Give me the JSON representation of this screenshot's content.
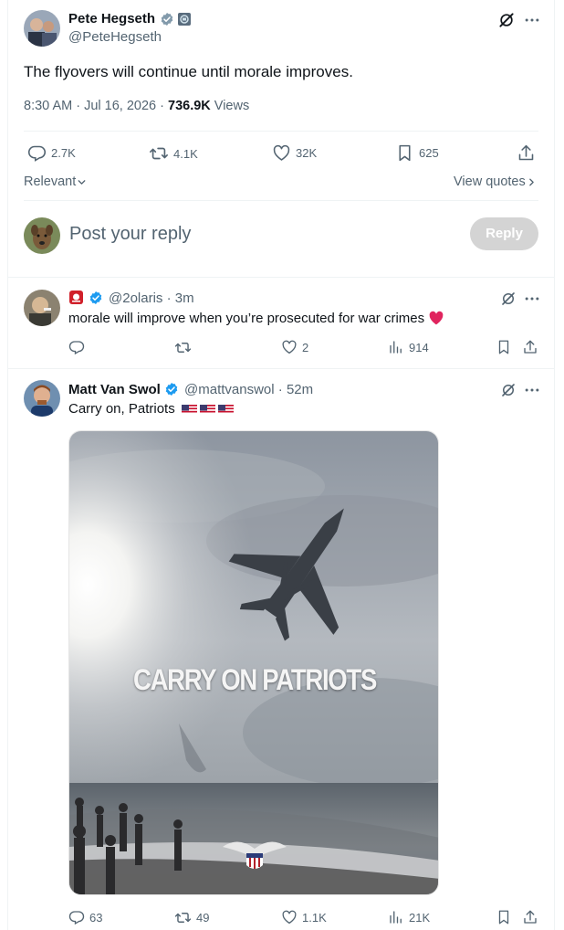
{
  "main_tweet": {
    "author_name": "Pete Hegseth",
    "author_handle": "@PeteHegseth",
    "text": "The flyovers will continue until morale improves.",
    "time": "8:30 AM",
    "date": "Jul 16, 2026",
    "views_count": "736.9K",
    "views_label": "Views",
    "stats": {
      "replies": "2.7K",
      "reposts": "4.1K",
      "likes": "32K",
      "bookmarks": "625"
    }
  },
  "sort": {
    "label": "Relevant",
    "view_quotes": "View quotes"
  },
  "composer": {
    "placeholder": "Post your reply",
    "reply_label": "Reply"
  },
  "replies": [
    {
      "author_handle": "@2olaris",
      "time": "3m",
      "text": "morale will improve when you’re prosecuted for war crimes",
      "stats": {
        "replies": "",
        "reposts": "",
        "likes": "2",
        "views": "914"
      }
    },
    {
      "author_name": "Matt Van Swol",
      "author_handle": "@mattvanswol",
      "time": "52m",
      "text": "Carry on, Patriots",
      "media_caption": "CARRY ON PATRIOTS",
      "stats": {
        "replies": "63",
        "reposts": "49",
        "likes": "1.1K",
        "views": "21K"
      }
    }
  ],
  "colors": {
    "verified": "#1d9bf0",
    "heart": "#e0245e",
    "reply_button": "#d4d4d4"
  },
  "icons": [
    "grok-icon",
    "more-icon",
    "reply-icon",
    "repost-icon",
    "like-icon",
    "bookmark-icon",
    "share-icon",
    "views-icon",
    "verified-icon"
  ]
}
